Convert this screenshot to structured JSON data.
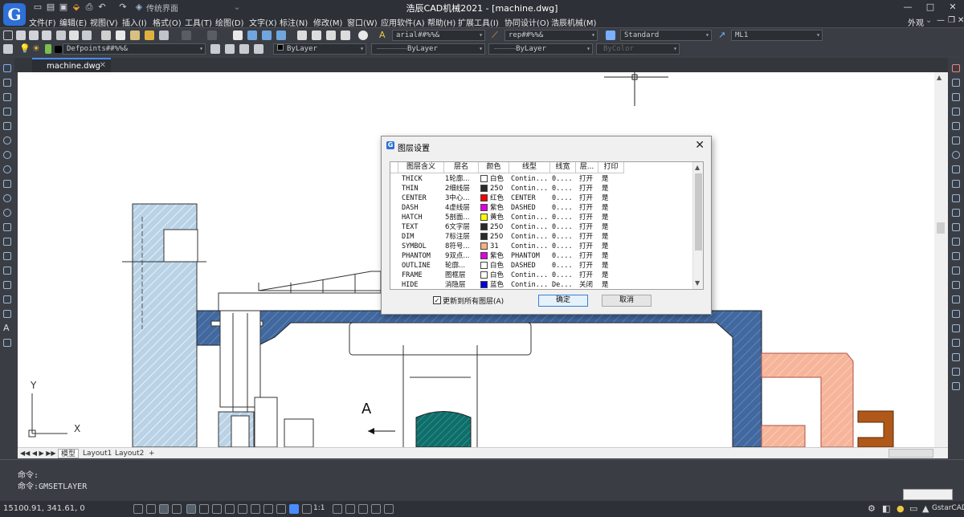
{
  "app": {
    "title": "浩辰CAD机械2021 - [machine.dwg]",
    "logo_letter": "G",
    "workspace": "传统界面",
    "window_controls": [
      "—",
      "□",
      "✕"
    ]
  },
  "menu": {
    "items": [
      "文件(F)",
      "编辑(E)",
      "视图(V)",
      "插入(I)",
      "格式(O)",
      "工具(T)",
      "绘图(D)",
      "文字(X)",
      "标注(N)",
      "修改(M)",
      "窗口(W)",
      "应用软件(A)",
      "帮助(H)",
      "扩展工具(I)",
      "协同设计(O)",
      "浩辰机械(M)"
    ],
    "appearance": "外观"
  },
  "toolbar": {
    "text_style": "arial##%%&",
    "dim_style": "rep##%%&",
    "table_style": "Standard",
    "mleader_style": "ML1",
    "layer": "Defpoints##%%&",
    "color": "ByLayer",
    "linetype": "ByLayer",
    "lineweight": "ByLayer",
    "plotstyle": "ByColor"
  },
  "document": {
    "tab_name": "machine.dwg"
  },
  "drawing": {
    "section_label": "A",
    "ucs_x": "X",
    "ucs_y": "Y"
  },
  "layout_tabs": [
    "模型",
    "Layout1",
    "Layout2",
    "+"
  ],
  "command": {
    "line1": "命令:",
    "line2": "命令:GMSETLAYER"
  },
  "status": {
    "coords": "15100.91, 341.61, 0",
    "scale": "1:1",
    "product": "GstarCAD"
  },
  "dialog": {
    "title": "图层设置",
    "columns": [
      "图层含义",
      "层名",
      "颜色",
      "线型",
      "线宽",
      "层...",
      "打印"
    ],
    "rows": [
      {
        "meaning": "THICK",
        "name": "1轮廓...",
        "color_hex": "#ffffff",
        "color": "白色",
        "linetype": "Contin...",
        "lineweight": "0....",
        "state": "打开",
        "print": "是"
      },
      {
        "meaning": "THIN",
        "name": "2细线层",
        "color_hex": "#2a2a2a",
        "color": "250",
        "linetype": "Contin...",
        "lineweight": "0....",
        "state": "打开",
        "print": "是"
      },
      {
        "meaning": "CENTER",
        "name": "3中心...",
        "color_hex": "#ff0000",
        "color": "红色",
        "linetype": "CENTER",
        "lineweight": "0....",
        "state": "打开",
        "print": "是"
      },
      {
        "meaning": "DASH",
        "name": "4虚线层",
        "color_hex": "#e000e0",
        "color": "紫色",
        "linetype": "DASHED",
        "lineweight": "0....",
        "state": "打开",
        "print": "是"
      },
      {
        "meaning": "HATCH",
        "name": "5剖面...",
        "color_hex": "#ffff00",
        "color": "黄色",
        "linetype": "Contin...",
        "lineweight": "0....",
        "state": "打开",
        "print": "是"
      },
      {
        "meaning": "TEXT",
        "name": "6文字层",
        "color_hex": "#2a2a2a",
        "color": "250",
        "linetype": "Contin...",
        "lineweight": "0....",
        "state": "打开",
        "print": "是"
      },
      {
        "meaning": "DIM",
        "name": "7标注层",
        "color_hex": "#2a2a2a",
        "color": "250",
        "linetype": "Contin...",
        "lineweight": "0....",
        "state": "打开",
        "print": "是"
      },
      {
        "meaning": "SYMBOL",
        "name": "8符号...",
        "color_hex": "#f4b183",
        "color": "31",
        "linetype": "Contin...",
        "lineweight": "0....",
        "state": "打开",
        "print": "是"
      },
      {
        "meaning": "PHANTOM",
        "name": "9双点...",
        "color_hex": "#e000e0",
        "color": "紫色",
        "linetype": "PHANTOM",
        "lineweight": "0....",
        "state": "打开",
        "print": "是"
      },
      {
        "meaning": "OUTLINE",
        "name": "轮廓...",
        "color_hex": "#ffffff",
        "color": "白色",
        "linetype": "DASHED",
        "lineweight": "0....",
        "state": "打开",
        "print": "是"
      },
      {
        "meaning": "FRAME",
        "name": "图框层",
        "color_hex": "#ffffff",
        "color": "白色",
        "linetype": "Contin...",
        "lineweight": "0....",
        "state": "打开",
        "print": "是"
      },
      {
        "meaning": "HIDE",
        "name": "消隐层",
        "color_hex": "#0000e0",
        "color": "蓝色",
        "linetype": "Contin...",
        "lineweight": "De...",
        "state": "关闭",
        "print": "是"
      }
    ],
    "update_all_label": "更新到所有图层(A)",
    "update_all_checked": true,
    "ok_label": "确定",
    "cancel_label": "取消"
  }
}
